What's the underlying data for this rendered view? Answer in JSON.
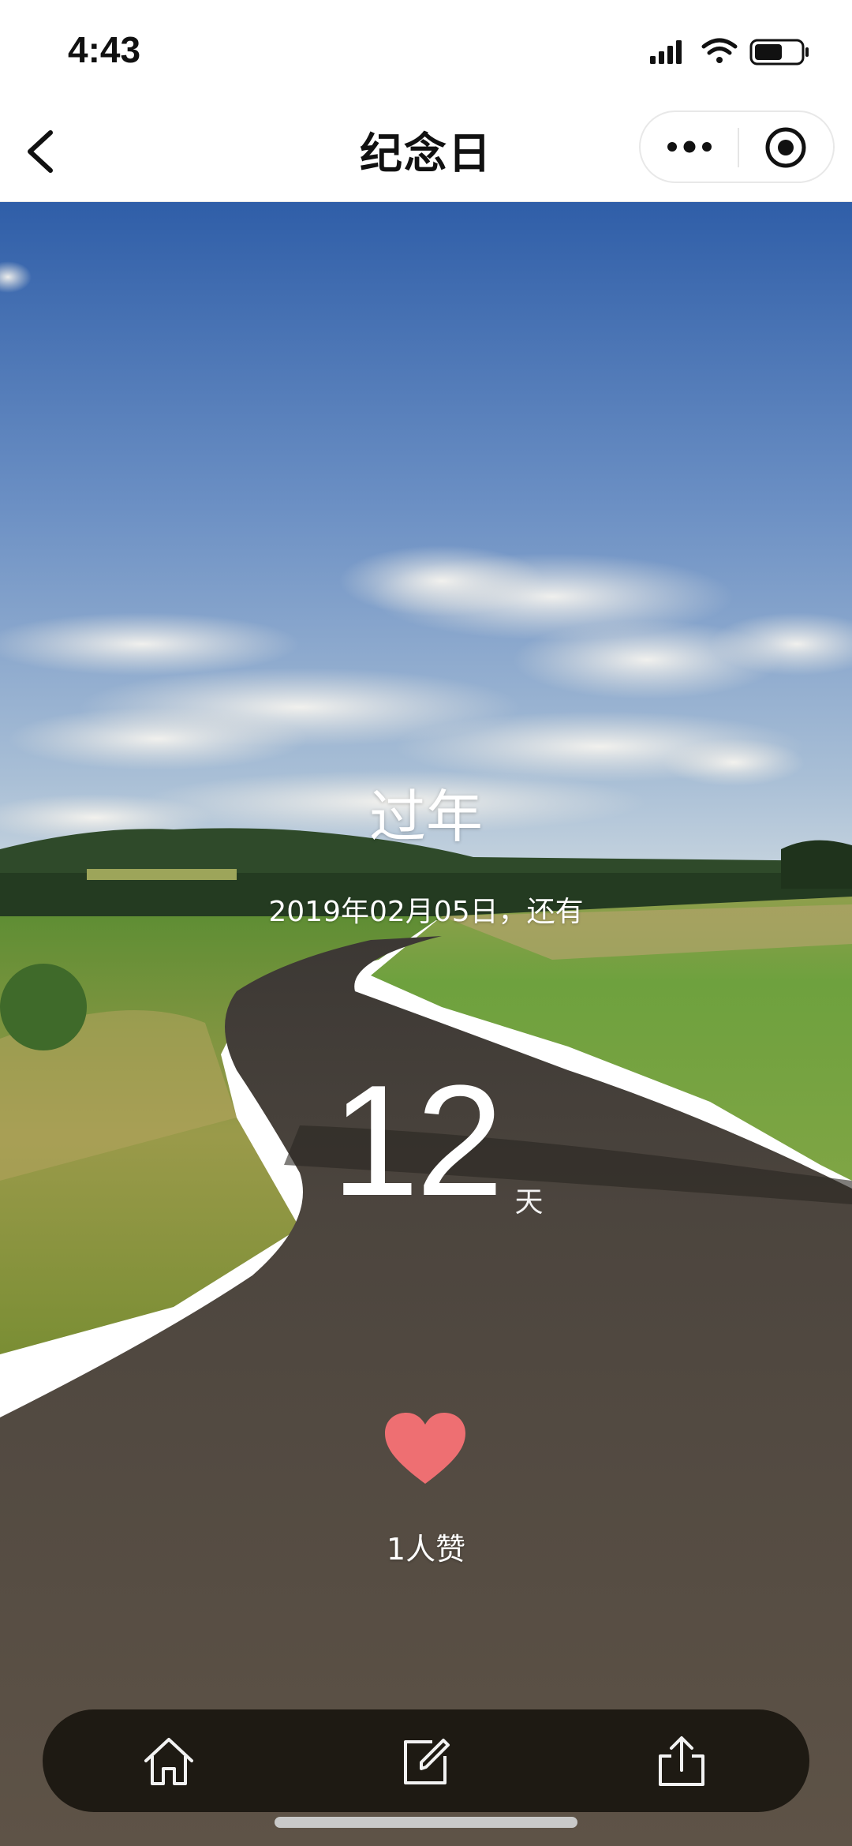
{
  "status_bar": {
    "time": "4:43"
  },
  "nav": {
    "title": "纪念日"
  },
  "event": {
    "title": "过年",
    "date_line": "2019年02月05日，还有",
    "days_remaining": "12",
    "days_unit": "天"
  },
  "likes": {
    "count_text": "1人赞",
    "heart_color": "#ee6f72"
  },
  "toolbar": {
    "buttons": [
      "home-icon",
      "edit-icon",
      "share-icon"
    ]
  },
  "colors": {
    "sky_top": "#3f6bb0",
    "grass": "#6f9a3c",
    "road": "#5a5148",
    "toolbar_bg": "#16120c"
  }
}
